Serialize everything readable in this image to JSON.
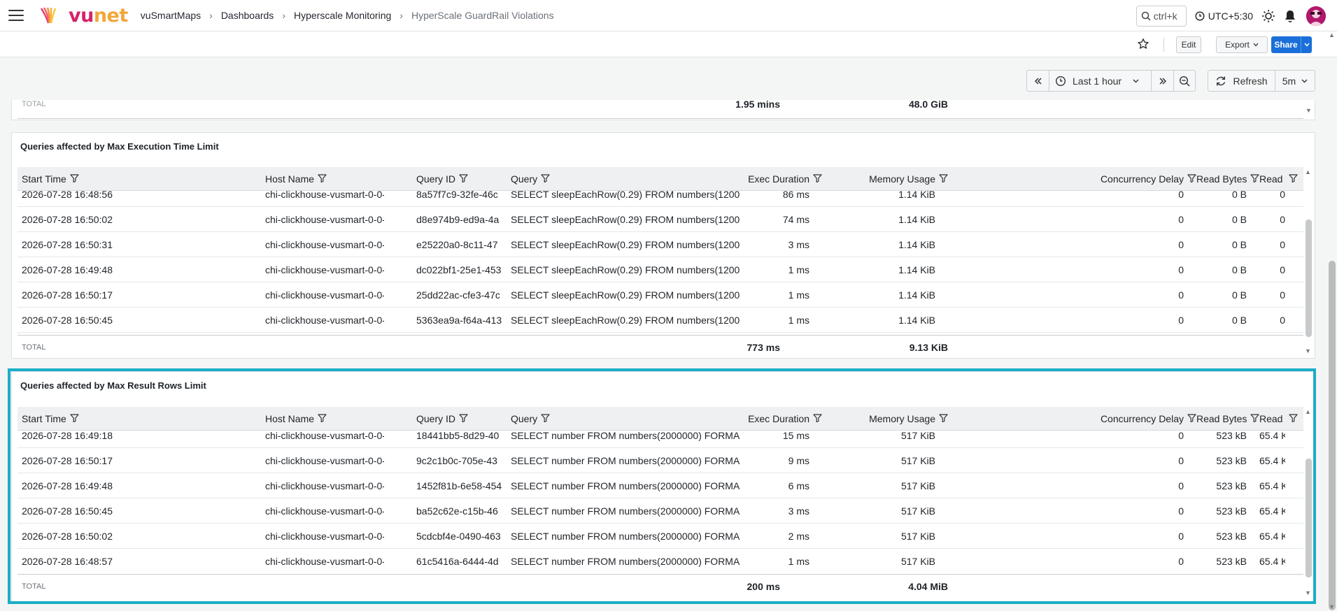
{
  "header": {
    "brand_vu": "vu",
    "brand_net": "net",
    "breadcrumbs": [
      "vuSmartMaps",
      "Dashboards",
      "Hyperscale Monitoring",
      "HyperScale GuardRail Violations"
    ],
    "search_shortcut": "ctrl+k",
    "timezone": "UTC+5:30"
  },
  "actions": {
    "edit": "Edit",
    "export": "Export",
    "share": "Share"
  },
  "timepicker": {
    "range": "Last 1 hour",
    "refresh": "Refresh",
    "interval": "5m"
  },
  "top_panel_footer": {
    "label": "TOTAL",
    "exec_total": "1.95 mins",
    "mem_total": "48.0 GiB"
  },
  "columns": [
    "Start Time",
    "Host Name",
    "Query ID",
    "Query",
    "Exec Duration",
    "Memory Usage",
    "Concurrency Delay",
    "Read Bytes",
    "Read Rows"
  ],
  "panels": [
    {
      "title": "Queries affected by Max Execution Time Limit",
      "rows": [
        [
          "2026-07-28 16:48:56",
          "chi-clickhouse-vusmart-0-0-0",
          "8a57f7c9-32fe-46c",
          "SELECT sleepEachRow(0.29) FROM numbers(1200",
          "86 ms",
          "1.14 KiB",
          "0",
          "0 B",
          "0"
        ],
        [
          "2026-07-28 16:50:02",
          "chi-clickhouse-vusmart-0-0-0",
          "d8e974b9-ed9a-4a",
          "SELECT sleepEachRow(0.29) FROM numbers(1200",
          "74 ms",
          "1.14 KiB",
          "0",
          "0 B",
          "0"
        ],
        [
          "2026-07-28 16:50:31",
          "chi-clickhouse-vusmart-0-0-0",
          "e25220a0-8c11-47",
          "SELECT sleepEachRow(0.29) FROM numbers(1200",
          "3 ms",
          "1.14 KiB",
          "0",
          "0 B",
          "0"
        ],
        [
          "2026-07-28 16:49:48",
          "chi-clickhouse-vusmart-0-0-0",
          "dc022bf1-25e1-453",
          "SELECT sleepEachRow(0.29) FROM numbers(1200",
          "1 ms",
          "1.14 KiB",
          "0",
          "0 B",
          "0"
        ],
        [
          "2026-07-28 16:50:17",
          "chi-clickhouse-vusmart-0-0-0",
          "25dd22ac-cfe3-47c",
          "SELECT sleepEachRow(0.29) FROM numbers(1200",
          "1 ms",
          "1.14 KiB",
          "0",
          "0 B",
          "0"
        ],
        [
          "2026-07-28 16:50:45",
          "chi-clickhouse-vusmart-0-0-0",
          "5363ea9a-f64a-413",
          "SELECT sleepEachRow(0.29) FROM numbers(1200",
          "1 ms",
          "1.14 KiB",
          "0",
          "0 B",
          "0"
        ]
      ],
      "footer": {
        "label": "TOTAL",
        "exec_total": "773 ms",
        "mem_total": "9.13 KiB"
      }
    },
    {
      "title": "Queries affected by Max Result Rows Limit",
      "rows": [
        [
          "2026-07-28 16:49:18",
          "chi-clickhouse-vusmart-0-0-0",
          "18441bb5-8d29-40",
          "SELECT number FROM numbers(2000000) FORMA",
          "15 ms",
          "517 KiB",
          "0",
          "523 kB",
          "65.4 K"
        ],
        [
          "2026-07-28 16:50:17",
          "chi-clickhouse-vusmart-0-0-0",
          "9c2c1b0c-705e-43",
          "SELECT number FROM numbers(2000000) FORMA",
          "9 ms",
          "517 KiB",
          "0",
          "523 kB",
          "65.4 K"
        ],
        [
          "2026-07-28 16:49:48",
          "chi-clickhouse-vusmart-0-0-0",
          "1452f81b-6e58-454",
          "SELECT number FROM numbers(2000000) FORMA",
          "6 ms",
          "517 KiB",
          "0",
          "523 kB",
          "65.4 K"
        ],
        [
          "2026-07-28 16:50:45",
          "chi-clickhouse-vusmart-0-0-0",
          "ba52c62e-c15b-46",
          "SELECT number FROM numbers(2000000) FORMA",
          "3 ms",
          "517 KiB",
          "0",
          "523 kB",
          "65.4 K"
        ],
        [
          "2026-07-28 16:50:02",
          "chi-clickhouse-vusmart-0-0-0",
          "5cdcbf4e-0490-463",
          "SELECT number FROM numbers(2000000) FORMA",
          "2 ms",
          "517 KiB",
          "0",
          "523 kB",
          "65.4 K"
        ],
        [
          "2026-07-28 16:48:57",
          "chi-clickhouse-vusmart-0-0-0",
          "61c5416a-6444-4d",
          "SELECT number FROM numbers(2000000) FORMA",
          "1 ms",
          "517 KiB",
          "0",
          "523 kB",
          "65.4 K"
        ]
      ],
      "footer": {
        "label": "TOTAL",
        "exec_total": "200 ms",
        "mem_total": "4.04 MiB"
      }
    }
  ],
  "colors": {
    "accent": "#1a6fd9",
    "highlight": "#1aaec5",
    "brand_vu": "#d6236b",
    "brand_net": "#f2a73b"
  },
  "icons": [
    "menu-icon",
    "vunet-logo-icon",
    "search-icon",
    "clock-icon",
    "sun-icon",
    "bell-icon",
    "avatar-icon",
    "star-icon",
    "chevron-down-icon",
    "double-chevron-left-icon",
    "double-chevron-right-icon",
    "zoom-out-icon",
    "refresh-icon",
    "filter-icon"
  ]
}
